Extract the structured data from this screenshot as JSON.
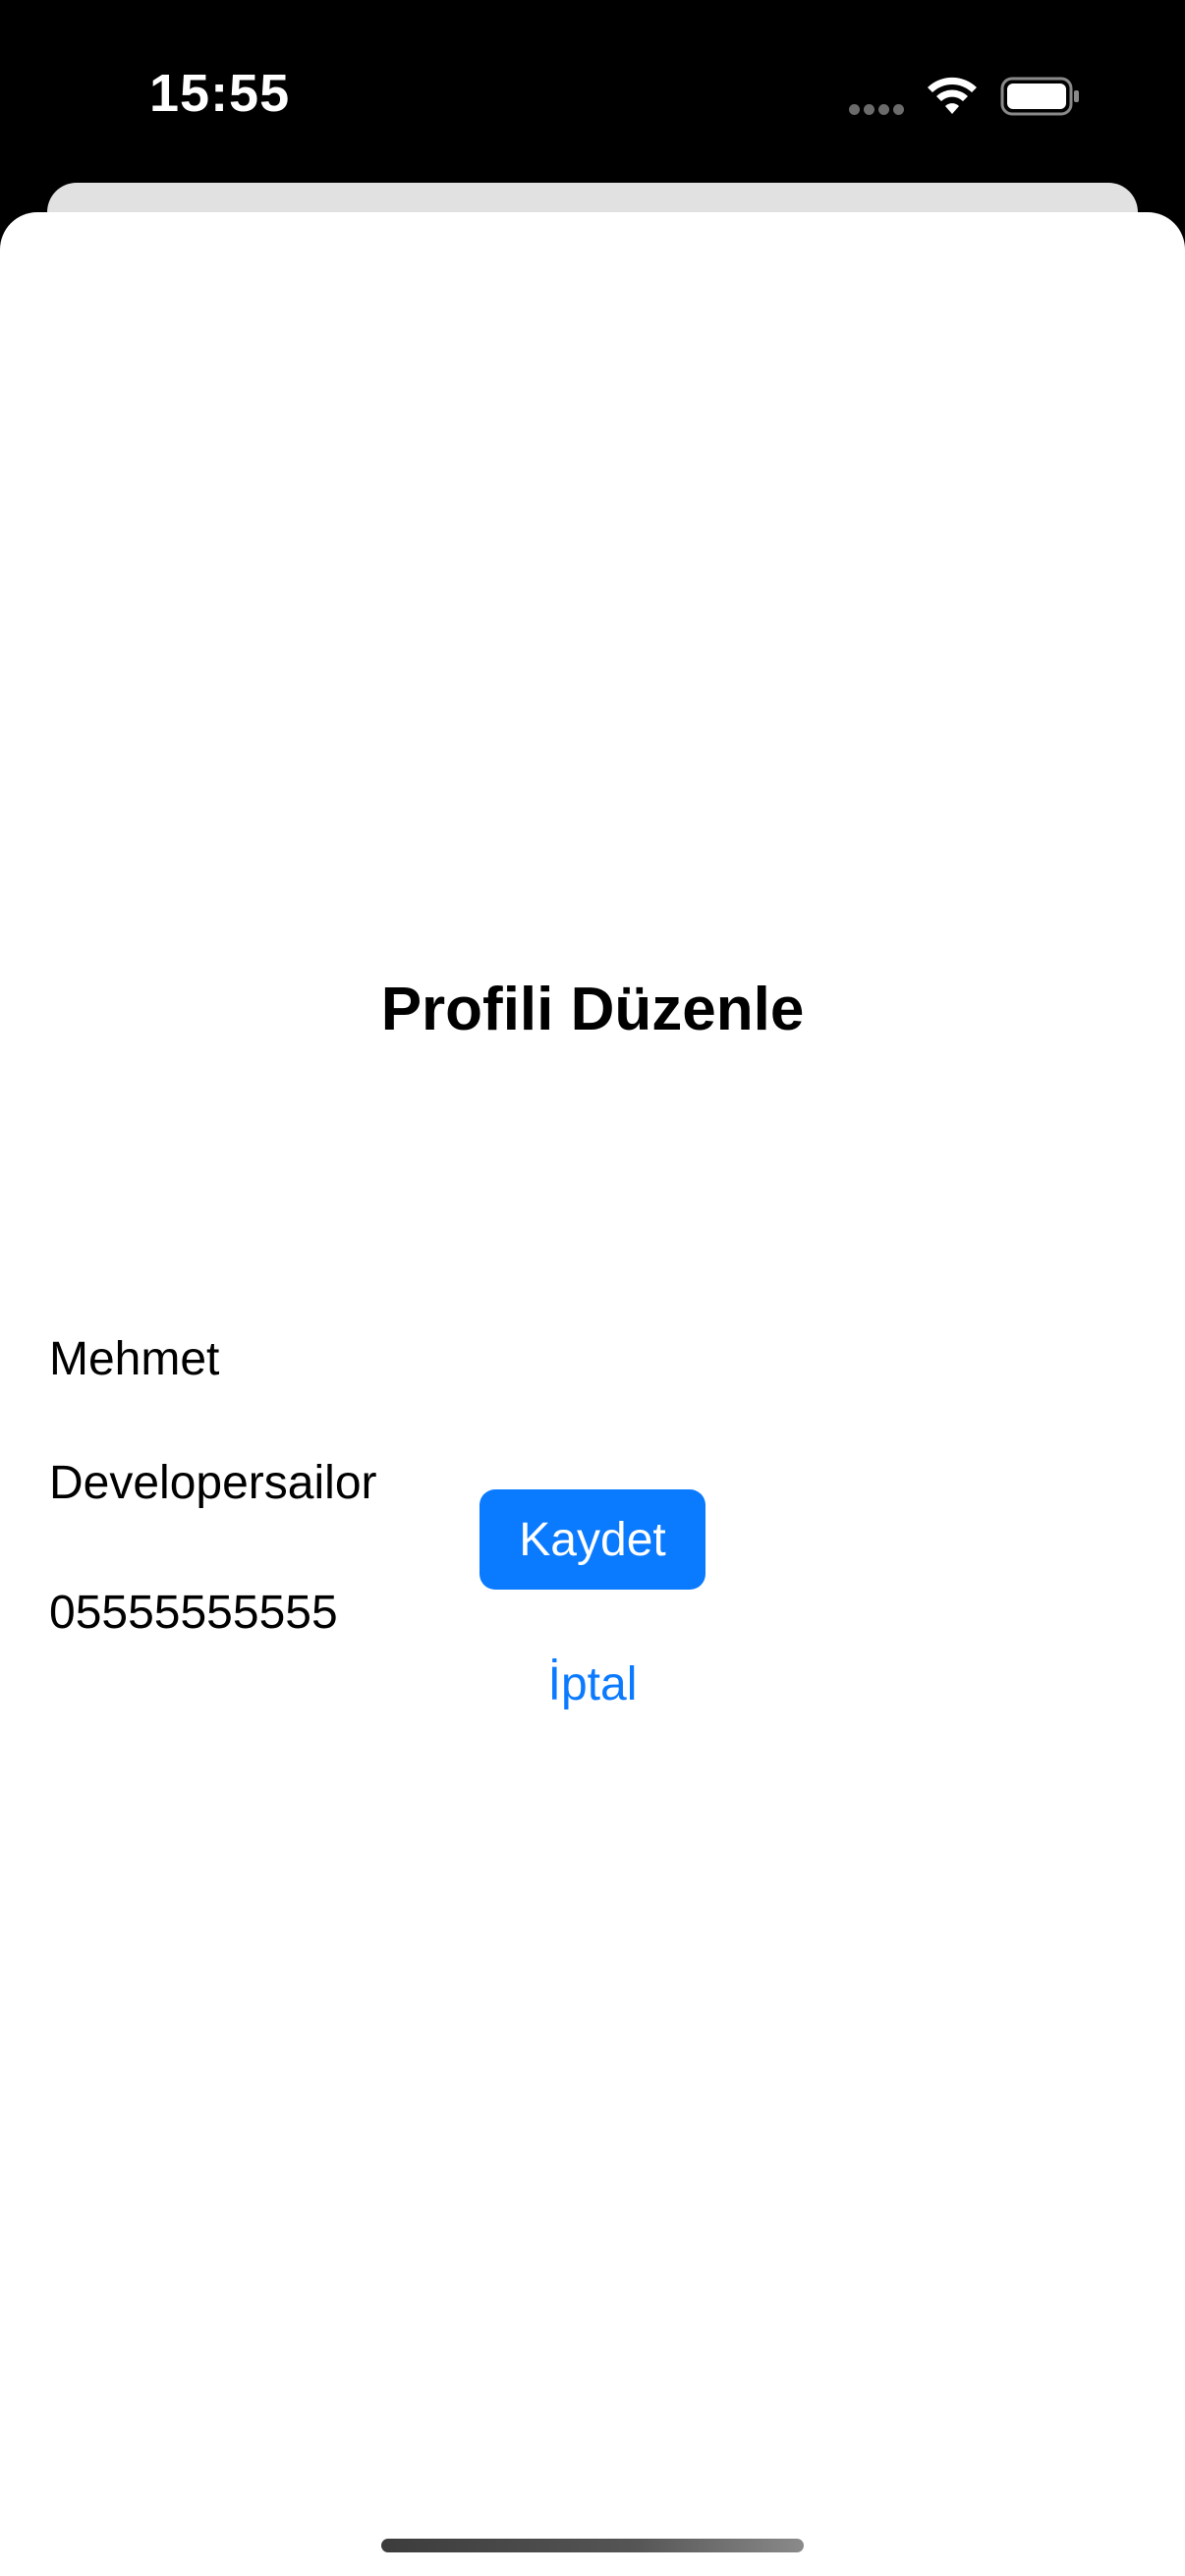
{
  "status_bar": {
    "time": "15:55",
    "icons": [
      "cellular-dots-icon",
      "wifi-icon",
      "battery-icon"
    ]
  },
  "sheet": {
    "title": "Profili Düzenle",
    "fields": {
      "name": "Mehmet",
      "company": "Developersailor",
      "phone": "05555555555"
    },
    "save_label": "Kaydet",
    "cancel_label": "İptal"
  },
  "colors": {
    "accent": "#0a7aff",
    "sheet_background": "#ffffff",
    "status_bar_background": "#000000",
    "back_card": "#e1e1e1"
  }
}
